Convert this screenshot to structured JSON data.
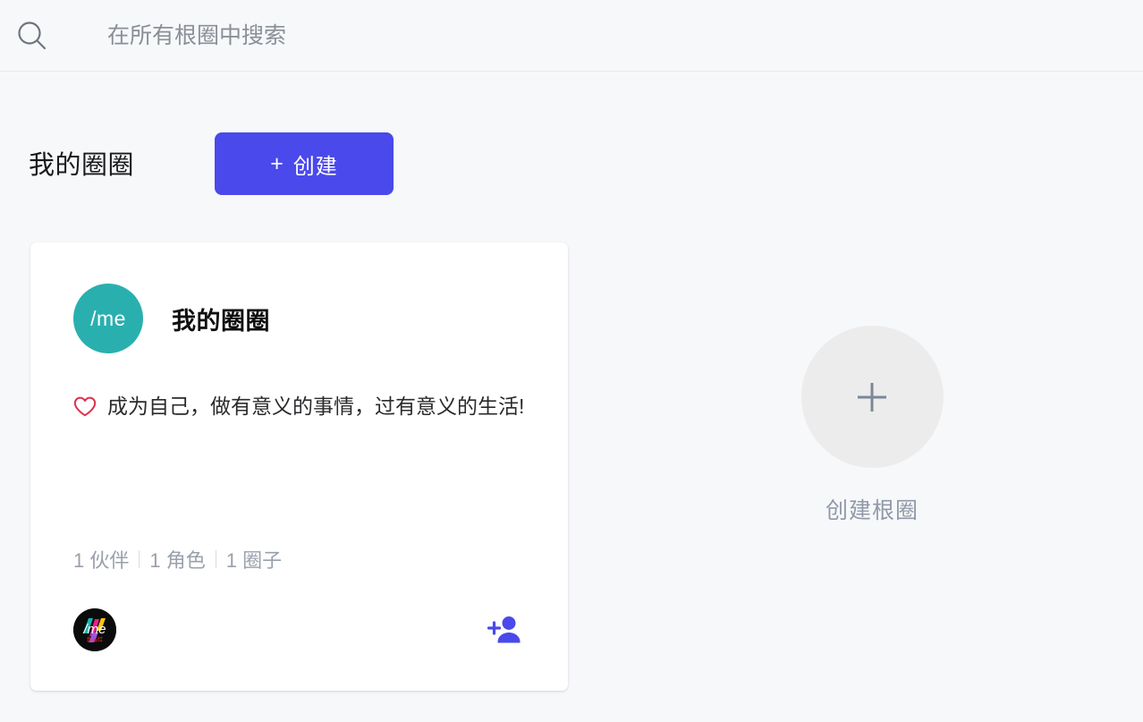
{
  "search": {
    "icon": "search-icon",
    "placeholder": "在所有根圈中搜索",
    "value": ""
  },
  "header": {
    "page_title": "我的圈圈",
    "create_button": {
      "plus": "+",
      "label": "创建"
    }
  },
  "circle_card": {
    "avatar_text": "/me",
    "avatar_color": "#2aafaf",
    "title": "我的圈圈",
    "heart_icon": "heart-outline-icon",
    "description": "成为自己，做有意义的事情，过有意义的生活!",
    "stats": [
      {
        "count": "1",
        "label": "伙伴"
      },
      {
        "count": "1",
        "label": "角色"
      },
      {
        "count": "1",
        "label": "圈子"
      }
    ],
    "stats_text": {
      "partners": "1 伙伴",
      "roles": "1 角色",
      "circles": "1 圈子"
    },
    "member_logo": {
      "name": "me-brand-logo",
      "text": "/me",
      "subtext": "我最红"
    },
    "add_member_icon": "add-person-icon"
  },
  "create_root": {
    "plus": "+",
    "label": "创建根圈"
  },
  "colors": {
    "accent": "#4a49eb",
    "avatar_teal": "#2aafaf",
    "heart_red": "#e0304f",
    "page_background": "#f7f8fa",
    "card_background": "#ffffff",
    "muted_text": "#9099a8"
  }
}
